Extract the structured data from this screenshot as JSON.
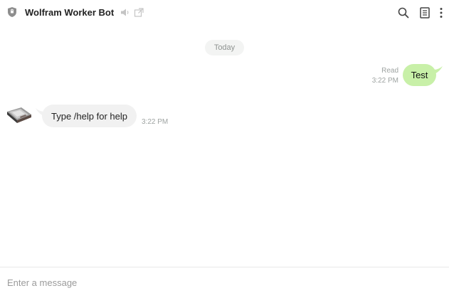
{
  "header": {
    "title": "Wolfram Worker Bot",
    "icons": [
      "bot-shield-icon",
      "mute-icon",
      "open-external-icon",
      "search-icon",
      "notes-icon",
      "more-vertical-icon"
    ]
  },
  "messages": {
    "date_label": "Today",
    "outgoing": {
      "text": "Test",
      "status": "Read",
      "time": "3:22 PM",
      "bubble_color": "#c8f0a8"
    },
    "incoming": {
      "text": "Type /help for help",
      "time": "3:22 PM",
      "bubble_color": "#f1f1f1",
      "avatar": "bot-avatar"
    }
  },
  "composer": {
    "placeholder": "Enter a message",
    "value": ""
  }
}
